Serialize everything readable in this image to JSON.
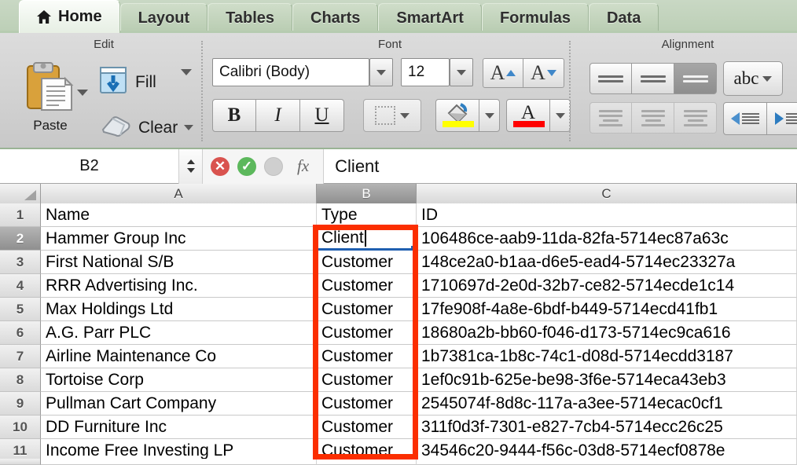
{
  "window": {
    "app": "Microsoft Excel",
    "accent_red": "#fb2e00",
    "selection_blue": "#1f5fb0",
    "tab_bar_green": "#bccfb6"
  },
  "ribbon": {
    "tabs": [
      {
        "label": "Home",
        "icon": "home-icon",
        "active": true
      },
      {
        "label": "Layout",
        "active": false
      },
      {
        "label": "Tables",
        "active": false
      },
      {
        "label": "Charts",
        "active": false
      },
      {
        "label": "SmartArt",
        "active": false
      },
      {
        "label": "Formulas",
        "active": false
      },
      {
        "label": "Data",
        "active": false
      }
    ],
    "groups": {
      "edit": {
        "title": "Edit",
        "paste_label": "Paste",
        "fill_label": "Fill",
        "clear_label": "Clear"
      },
      "font": {
        "title": "Font",
        "font_name": "Calibri (Body)",
        "font_size": "12",
        "bold_label": "B",
        "italic_label": "I",
        "underline_label": "U",
        "grow_label": "A",
        "shrink_label": "A",
        "font_color_label": "A",
        "highlight_color": "#ffff00",
        "font_color": "#ff0000"
      },
      "alignment": {
        "title": "Alignment",
        "abc_label": "abc"
      }
    }
  },
  "formula_bar": {
    "name_box": "B2",
    "cancel_glyph": "✕",
    "confirm_glyph": "✓",
    "fx_label": "fx",
    "content": "Client"
  },
  "sheet": {
    "columns": [
      {
        "id": "A",
        "selected": false
      },
      {
        "id": "B",
        "selected": true
      },
      {
        "id": "C",
        "selected": false
      }
    ],
    "active_cell": "B2",
    "editing": true,
    "rows": [
      {
        "num": "1",
        "selected": false,
        "A": "Name",
        "B": "Type",
        "C": "ID"
      },
      {
        "num": "2",
        "selected": true,
        "A": "Hammer Group Inc",
        "B": "Client",
        "C": "106486ce-aab9-11da-82fa-5714ec87a63c"
      },
      {
        "num": "3",
        "selected": false,
        "A": "First National S/B",
        "B": "Customer",
        "C": "148ce2a0-b1aa-d6e5-ead4-5714ec23327a"
      },
      {
        "num": "4",
        "selected": false,
        "A": "RRR Advertising Inc.",
        "B": "Customer",
        "C": "1710697d-2e0d-32b7-ce82-5714ecde1c14"
      },
      {
        "num": "5",
        "selected": false,
        "A": "Max Holdings Ltd",
        "B": "Customer",
        "C": "17fe908f-4a8e-6bdf-b449-5714ecd41fb1"
      },
      {
        "num": "6",
        "selected": false,
        "A": "A.G. Parr PLC",
        "B": "Customer",
        "C": "18680a2b-bb60-f046-d173-5714ec9ca616"
      },
      {
        "num": "7",
        "selected": false,
        "A": "Airline Maintenance Co",
        "B": "Customer",
        "C": "1b7381ca-1b8c-74c1-d08d-5714ecdd3187"
      },
      {
        "num": "8",
        "selected": false,
        "A": "Tortoise Corp",
        "B": "Customer",
        "C": "1ef0c91b-625e-be98-3f6e-5714eca43eb3"
      },
      {
        "num": "9",
        "selected": false,
        "A": "Pullman Cart Company",
        "B": "Customer",
        "C": "2545074f-8d8c-117a-a3ee-5714ecac0cf1"
      },
      {
        "num": "10",
        "selected": false,
        "A": "DD Furniture Inc",
        "B": "Customer",
        "C": "311f0d3f-7301-e827-7cb4-5714ecc26c25"
      },
      {
        "num": "11",
        "selected": false,
        "A": "Income Free Investing LP",
        "B": "Customer",
        "C": "34546c20-9444-f56c-03d8-5714ecf0878e"
      }
    ]
  },
  "annotation": {
    "shape": "rectangle",
    "color": "#fb2e00",
    "covers": "column B cells B2 through B11"
  }
}
